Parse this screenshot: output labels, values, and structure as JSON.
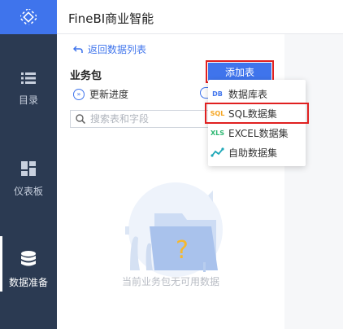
{
  "app": {
    "title": "FineBI商业智能"
  },
  "sidebar": {
    "items": [
      {
        "label": "目录",
        "icon": "list-icon"
      },
      {
        "label": "仪表板",
        "icon": "dashboard-icon"
      },
      {
        "label": "数据准备",
        "icon": "database-icon",
        "active": true
      }
    ]
  },
  "panel": {
    "back_label": "返回数据列表",
    "package_title": "业务包",
    "add_table_label": "添加表",
    "update_progress_label": "更新进度",
    "search_placeholder": "搜索表和字段",
    "empty_text": "当前业务包无可用数据"
  },
  "dropdown": {
    "items": [
      {
        "icon_text": "DB",
        "label": "数据库表"
      },
      {
        "icon_text": "SQL",
        "label": "SQL数据集",
        "highlighted": true
      },
      {
        "icon_text": "XLS",
        "label": "EXCEL数据集"
      },
      {
        "icon_text": "",
        "label": "自助数据集"
      }
    ]
  },
  "colors": {
    "accent": "#3f74ec",
    "sidebar": "#2b3a52",
    "highlight": "#e02020"
  }
}
